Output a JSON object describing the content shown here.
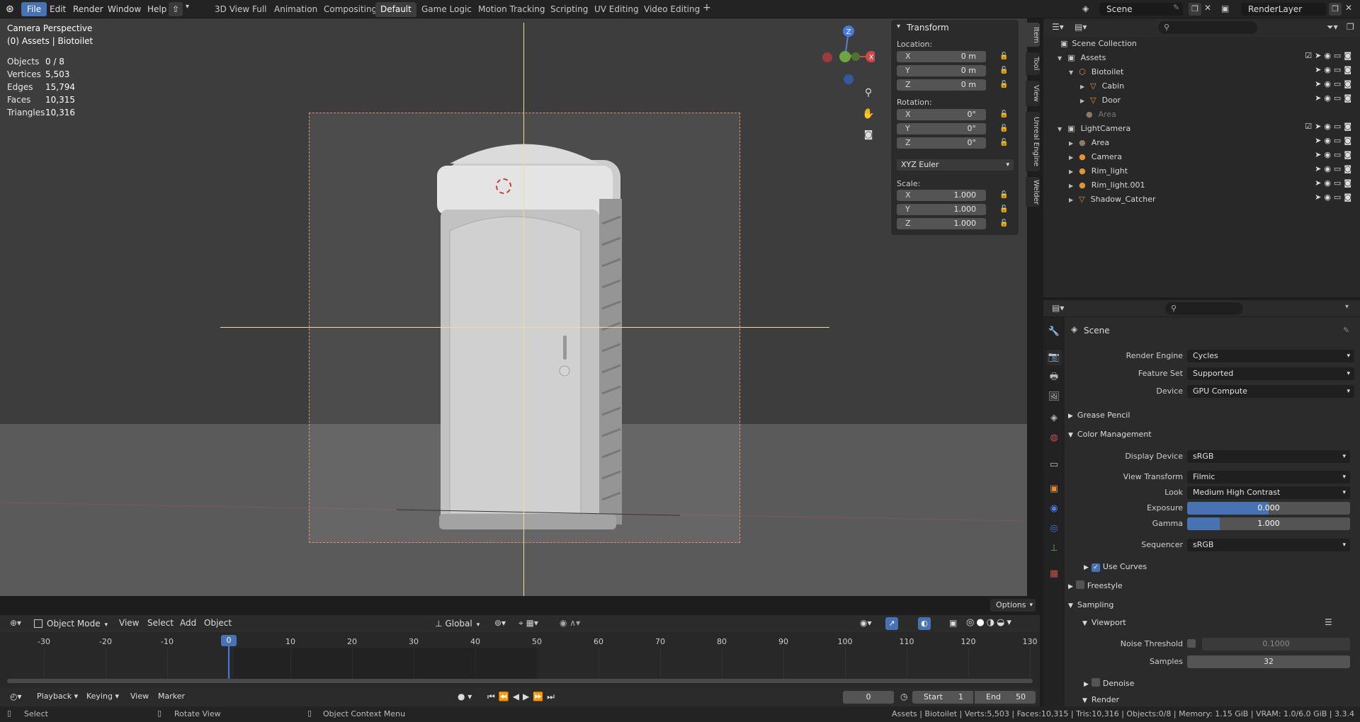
{
  "menu": {
    "file": "File",
    "edit": "Edit",
    "render": "Render",
    "window": "Window",
    "help": "Help"
  },
  "workspaces": [
    "3D View Full",
    "Animation",
    "Compositing",
    "Default",
    "Game Logic",
    "Motion Tracking",
    "Scripting",
    "UV Editing",
    "Video Editing"
  ],
  "active_workspace": "Default",
  "scene_field": "Scene",
  "renderlayer_field": "RenderLayer",
  "viewport": {
    "title": "Camera Perspective",
    "subtitle": "(0) Assets | Biotoilet",
    "stats": [
      {
        "label": "Objects",
        "value": "0 / 8"
      },
      {
        "label": "Vertices",
        "value": "5,503"
      },
      {
        "label": "Edges",
        "value": "15,794"
      },
      {
        "label": "Faces",
        "value": "10,315"
      },
      {
        "label": "Triangles",
        "value": "10,316"
      }
    ],
    "gizmo": {
      "z": "Z",
      "y": "Y",
      "x": "X"
    }
  },
  "transform": {
    "title": "Transform",
    "location_label": "Location:",
    "location": [
      {
        "axis": "X",
        "value": "0 m"
      },
      {
        "axis": "Y",
        "value": "0 m"
      },
      {
        "axis": "Z",
        "value": "0 m"
      }
    ],
    "rotation_label": "Rotation:",
    "rotation": [
      {
        "axis": "X",
        "value": "0°"
      },
      {
        "axis": "Y",
        "value": "0°"
      },
      {
        "axis": "Z",
        "value": "0°"
      }
    ],
    "rotation_mode": "XYZ Euler",
    "scale_label": "Scale:",
    "scale": [
      {
        "axis": "X",
        "value": "1.000"
      },
      {
        "axis": "Y",
        "value": "1.000"
      },
      {
        "axis": "Z",
        "value": "1.000"
      }
    ]
  },
  "side_tabs": [
    "Item",
    "Tool",
    "View",
    "Unreal Engine",
    "Welder"
  ],
  "options_label": "Options",
  "viewport_header": {
    "mode": "Object Mode",
    "view": "View",
    "select": "Select",
    "add": "Add",
    "object": "Object",
    "orientation": "Global"
  },
  "timeline": {
    "ticks": [
      "-30",
      "-20",
      "-10",
      "0",
      "10",
      "20",
      "30",
      "40",
      "50",
      "60",
      "70",
      "80",
      "90",
      "100",
      "110",
      "120",
      "130"
    ],
    "current": "0",
    "current_frame_field": "0",
    "start_label": "Start",
    "start": "1",
    "end_label": "End",
    "end": "50",
    "playback": "Playback",
    "keying": "Keying",
    "view": "View",
    "marker": "Marker"
  },
  "status": {
    "select": "Select",
    "rotate": "Rotate View",
    "context": "Object Context Menu",
    "info": "Assets | Biotoilet | Verts:5,503 | Faces:10,315 | Tris:10,316 | Objects:0/8 | Memory: 1.15 GiB | VRAM: 1.0/6.0 GiB | 3.3.4"
  },
  "outliner": {
    "root": "Scene Collection",
    "rows": [
      {
        "label": "Assets",
        "indent": 1
      },
      {
        "label": "Biotoilet",
        "indent": 2
      },
      {
        "label": "Cabin",
        "indent": 3
      },
      {
        "label": "Door",
        "indent": 3
      },
      {
        "label": "Area",
        "indent": 3,
        "dim": true
      },
      {
        "label": "LightCamera",
        "indent": 1
      },
      {
        "label": "Area",
        "indent": 2
      },
      {
        "label": "Camera",
        "indent": 2
      },
      {
        "label": "Rim_light",
        "indent": 2
      },
      {
        "label": "Rim_light.001",
        "indent": 2
      },
      {
        "label": "Shadow_Catcher",
        "indent": 2
      }
    ]
  },
  "properties": {
    "title": "Scene",
    "render_engine_label": "Render Engine",
    "render_engine": "Cycles",
    "feature_set_label": "Feature Set",
    "feature_set": "Supported",
    "device_label": "Device",
    "device": "GPU Compute",
    "grease_pencil": "Grease Pencil",
    "color_management": "Color Management",
    "display_device_label": "Display Device",
    "display_device": "sRGB",
    "view_transform_label": "View Transform",
    "view_transform": "Filmic",
    "look_label": "Look",
    "look": "Medium High Contrast",
    "exposure_label": "Exposure",
    "exposure": "0.000",
    "exposure_fill": 0.5,
    "gamma_label": "Gamma",
    "gamma": "1.000",
    "gamma_fill": 0.2,
    "sequencer_label": "Sequencer",
    "sequencer": "sRGB",
    "use_curves": "Use Curves",
    "freestyle": "Freestyle",
    "sampling": "Sampling",
    "viewport": "Viewport",
    "noise_threshold_label": "Noise Threshold",
    "noise_threshold": "0.1000",
    "samples_label": "Samples",
    "samples": "32",
    "denoise": "Denoise",
    "render": "Render"
  }
}
